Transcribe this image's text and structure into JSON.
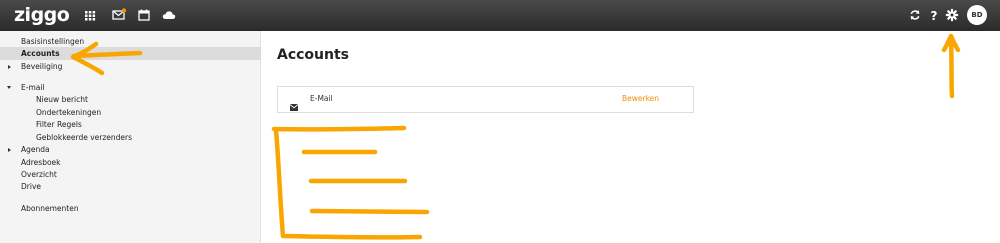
{
  "brand": {
    "logo_text": "ziggo"
  },
  "header": {
    "left_icons": [
      "apps-grid-icon",
      "mail-icon",
      "calendar-icon",
      "cloud-icon"
    ],
    "right_icons": [
      "refresh-icon",
      "help-icon",
      "gear-icon"
    ],
    "avatar_initials": "BD",
    "mail_notification_color": "#f48c06"
  },
  "sidebar": {
    "items": [
      {
        "label": "Basisinstellingen",
        "active": false
      },
      {
        "label": "Accounts",
        "active": true
      },
      {
        "label": "Beveiliging",
        "caret": "collapsed"
      },
      {
        "label": "E-mail",
        "caret": "expanded"
      },
      {
        "label": "Nieuw bericht"
      },
      {
        "label": "Ondertekeningen"
      },
      {
        "label": "Filter Regels"
      },
      {
        "label": "Geblokkeerde verzenders"
      },
      {
        "label": "Agenda",
        "caret": "collapsed"
      },
      {
        "label": "Adresboek"
      },
      {
        "label": "Overzicht"
      },
      {
        "label": "Drive"
      },
      {
        "label": "Abonnementen"
      }
    ]
  },
  "main": {
    "title": "Accounts",
    "accounts": [
      {
        "icon": "envelope-icon",
        "name": "E-Mail",
        "action": "Bewerken"
      }
    ]
  },
  "annotations": {
    "color": "#f9a602"
  }
}
